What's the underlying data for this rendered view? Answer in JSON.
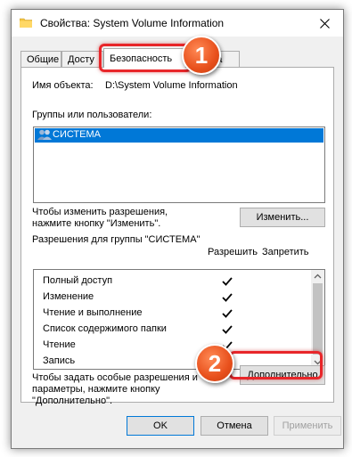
{
  "window": {
    "title": "Свойства: System Volume Information",
    "icon": "folder-icon"
  },
  "tabs": [
    {
      "label": "Общие"
    },
    {
      "label": "Досту"
    },
    {
      "label": "Безопасность",
      "active": true
    },
    {
      "label": "йка"
    }
  ],
  "security": {
    "object_label": "Имя объекта:",
    "object_value": "D:\\System Volume Information",
    "groups_label": "Группы или пользователи:",
    "groups": [
      {
        "name": "СИСТЕМА",
        "icon": "users-icon",
        "selected": true
      }
    ],
    "change_hint_line1": "Чтобы изменить разрешения,",
    "change_hint_line2": "нажмите кнопку \"Изменить\".",
    "change_button": "Изменить...",
    "perm_title": "Разрешения для группы \"СИСТЕМА\"",
    "allow_header": "Разрешить",
    "deny_header": "Запретить",
    "permissions": [
      {
        "name": "Полный доступ",
        "allow": true
      },
      {
        "name": "Изменение",
        "allow": true
      },
      {
        "name": "Чтение и выполнение",
        "allow": true
      },
      {
        "name": "Список содержимого папки",
        "allow": true
      },
      {
        "name": "Чтение",
        "allow": true
      },
      {
        "name": "Запись",
        "allow": true
      }
    ],
    "special_hint_line1": "Чтобы задать особые разрешения и",
    "special_hint_line2": "параметры, нажмите кнопку",
    "special_hint_line3": "\"Дополнительно\".",
    "advanced_button": "Дополнительно"
  },
  "footer": {
    "ok": "OK",
    "cancel": "Отмена",
    "apply": "Применить"
  },
  "annotations": {
    "badge1": "1",
    "badge2": "2"
  },
  "colors": {
    "selection": "#0078d7",
    "highlight": "#e8262a",
    "badge": "#e8501c"
  }
}
